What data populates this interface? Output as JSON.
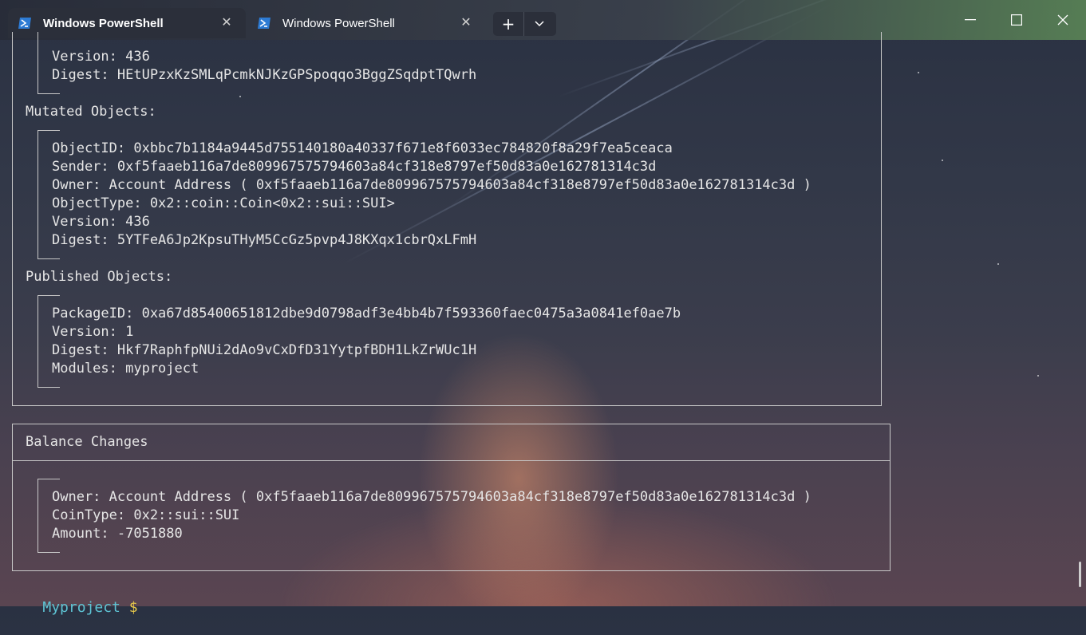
{
  "window": {
    "tabs": [
      {
        "label": "Windows PowerShell",
        "active": true
      },
      {
        "label": "Windows PowerShell",
        "active": false
      }
    ],
    "close_glyph": "✕",
    "new_tab_glyph": "+",
    "dropdown_glyph": "⌄",
    "minimize_glyph": "—",
    "maximize_glyph": "☐",
    "close_window_glyph": "✕",
    "icon": "powershell-icon"
  },
  "terminal": {
    "top_object": {
      "version": "Version: 436",
      "digest": "Digest: HEtUPzxKzSMLqPcmkNJKzGPSpoqqo3BggZSqdptTQwrh"
    },
    "mutated": {
      "header": "Mutated Objects:",
      "lines": [
        "ObjectID: 0xbbc7b1184a9445d755140180a40337f671e8f6033ec784820f8a29f7ea5ceaca",
        "Sender: 0xf5faaeb116a7de809967575794603a84cf318e8797ef50d83a0e162781314c3d",
        "Owner: Account Address ( 0xf5faaeb116a7de809967575794603a84cf318e8797ef50d83a0e162781314c3d )",
        "ObjectType: 0x2::coin::Coin<0x2::sui::SUI>",
        "Version: 436",
        "Digest: 5YTFeA6Jp2KpsuTHyM5CcGz5pvp4J8KXqx1cbrQxLFmH"
      ]
    },
    "published": {
      "header": "Published Objects:",
      "lines": [
        "PackageID: 0xa67d85400651812dbe9d0798adf3e4bb4b7f593360faec0475a3a0841ef0ae7b",
        "Version: 1",
        "Digest: Hkf7RaphfpNUi2dAo9vCxDfD31YytpfBDH1LkZrWUc1H",
        "Modules: myproject"
      ]
    },
    "balance": {
      "header": "Balance Changes",
      "lines": [
        "Owner: Account Address ( 0xf5faaeb116a7de809967575794603a84cf318e8797ef50d83a0e162781314c3d )",
        "CoinType: 0x2::sui::SUI",
        "Amount: -7051880"
      ]
    },
    "prompt": {
      "dir": "Myproject",
      "symbol": "$"
    }
  },
  "colors": {
    "prompt_dir": "#5ec4d4",
    "prompt_symbol": "#e6c84a",
    "text": "#e6e6e6"
  }
}
